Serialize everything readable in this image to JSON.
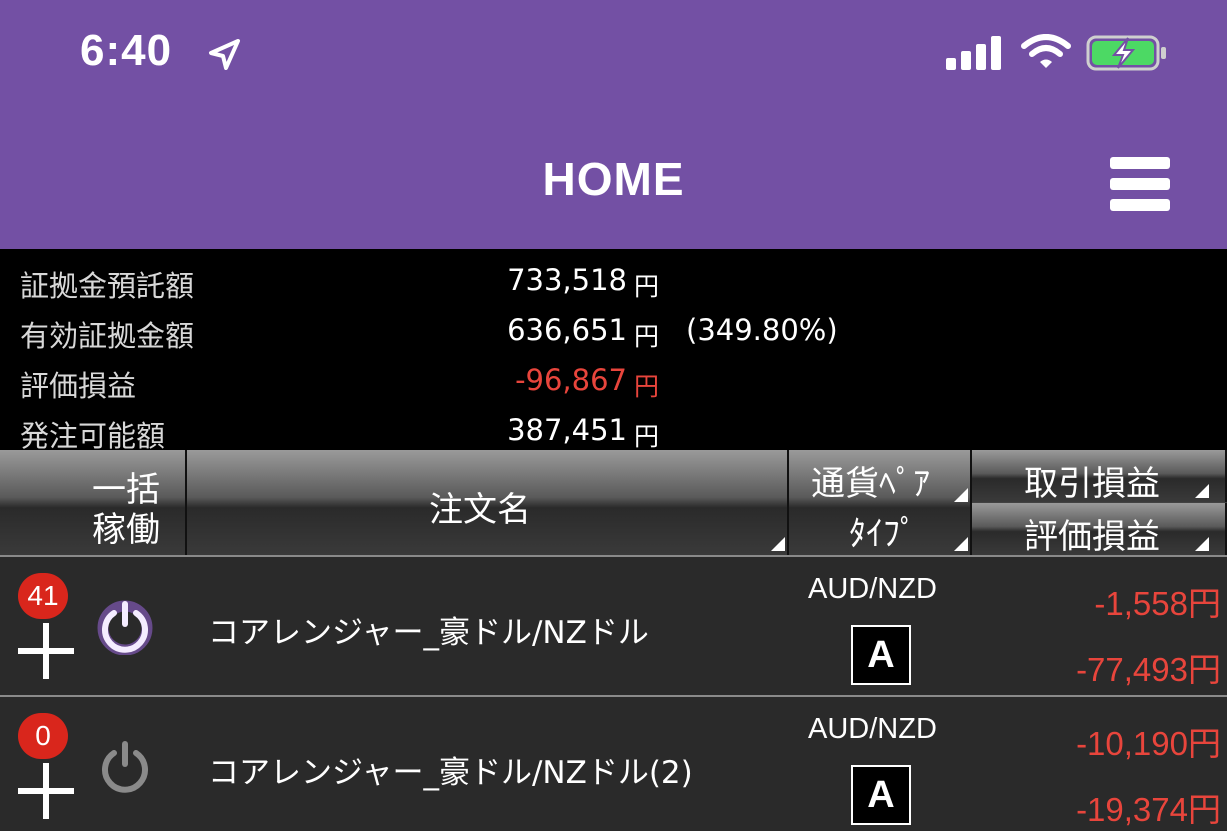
{
  "status": {
    "time": "6:40"
  },
  "nav": {
    "title": "HOME"
  },
  "summary": [
    {
      "label": "証拠金預託額",
      "value": "733,518",
      "unit": "円",
      "extra": ""
    },
    {
      "label": "有効証拠金額",
      "value": "636,651",
      "unit": "円",
      "extra": "(349.80%)"
    },
    {
      "label": "評価損益",
      "value": "-96,867",
      "unit": "円",
      "extra": ""
    },
    {
      "label": "発注可能額",
      "value": "387,451",
      "unit": "円",
      "extra": ""
    }
  ],
  "header": {
    "bulk_line1": "一括",
    "bulk_line2": "稼働",
    "order_name": "注文名",
    "pair_line1": "通貨ﾍﾟｱ",
    "pair_line2": "ﾀｲﾌﾟ",
    "trade_pl": "取引損益",
    "eval_pl": "評価損益"
  },
  "rows": [
    {
      "count": "41",
      "active": true,
      "name": "コアレンジャー_豪ドル/NZドル",
      "pair": "AUD/NZD",
      "type": "A",
      "trade_pl": "-1,558円",
      "eval_pl": "-77,493円"
    },
    {
      "count": "0",
      "active": false,
      "name": "コアレンジャー_豪ドル/NZドル(2)",
      "pair": "AUD/NZD",
      "type": "A",
      "trade_pl": "-10,190円",
      "eval_pl": "-19,374円"
    }
  ],
  "colors": {
    "accent": "#7350a4",
    "negative": "#e8453c",
    "badge": "#d9261c",
    "power_active": "#b070ff"
  }
}
